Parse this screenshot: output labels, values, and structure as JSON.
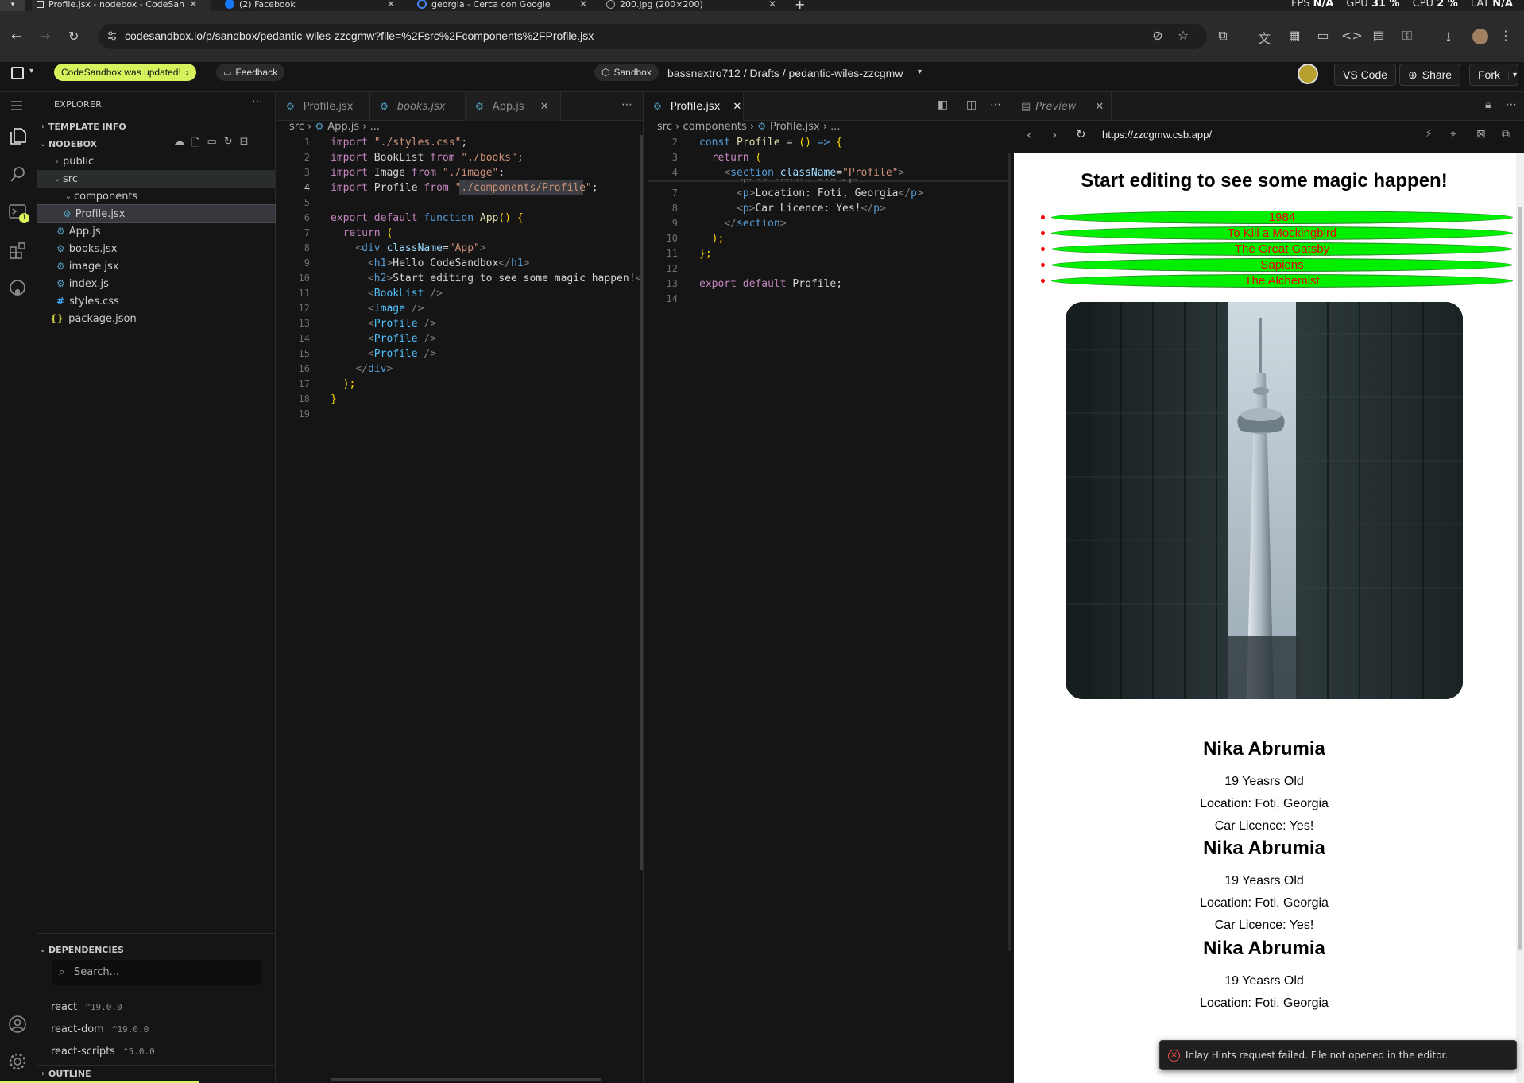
{
  "browser": {
    "tabs": [
      {
        "title": "Profile.jsx - nodebox - CodeSan",
        "icon": "codesandbox-icon"
      },
      {
        "title": "(2) Facebook",
        "icon": "facebook-icon"
      },
      {
        "title": "georgia - Cerca con Google",
        "icon": "google-icon"
      },
      {
        "title": "200.jpg (200×200)",
        "icon": "globe-icon"
      }
    ],
    "new_tab": "+",
    "stats": {
      "fps_label": "FPS",
      "fps": "N/A",
      "gpu_label": "GPU",
      "gpu": "31 %",
      "cpu_label": "CPU",
      "cpu": "2 %",
      "lat_label": "LAT",
      "lat": "N/A"
    },
    "url": "codesandbox.io/p/sandbox/pedantic-wiles-zzcgmw?file=%2Fsrc%2Fcomponents%2FProfile.jsx"
  },
  "header": {
    "update_badge": "CodeSandbox was updated!",
    "feedback": "Feedback",
    "sandbox_badge": "Sandbox",
    "breadcrumb": "bassnextro712 / Drafts / pedantic-wiles-zzcgmw",
    "vscode": "VS Code",
    "share": "Share",
    "fork": "Fork"
  },
  "explorer": {
    "title": "EXPLORER",
    "template_info": "TEMPLATE INFO",
    "project": "NODEBOX",
    "tree": {
      "public": "public",
      "src": "src",
      "components": "components",
      "profile": "Profile.jsx",
      "app": "App.js",
      "books": "books.jsx",
      "image": "image.jsx",
      "index": "index.js",
      "styles": "styles.css",
      "package": "package.json"
    },
    "dependencies_title": "DEPENDENCIES",
    "search_placeholder": "Search...",
    "dependencies": [
      {
        "name": "react",
        "version": "^19.0.0"
      },
      {
        "name": "react-dom",
        "version": "^19.0.0"
      },
      {
        "name": "react-scripts",
        "version": "^5.0.0"
      }
    ],
    "outline": "OUTLINE",
    "terminal_badge": "1"
  },
  "editor_left": {
    "tabs": [
      "Profile.jsx",
      "books.jsx",
      "App.js"
    ],
    "breadcrumb": [
      "src",
      "App.js",
      "..."
    ],
    "line_numbers": [
      "1",
      "2",
      "3",
      "4",
      "5",
      "6",
      "7",
      "8",
      "9",
      "10",
      "11",
      "12",
      "13",
      "14",
      "15",
      "16",
      "17",
      "18",
      "19"
    ]
  },
  "editor_right": {
    "tab": "Profile.jsx",
    "breadcrumb": [
      "src",
      "components",
      "Profile.jsx",
      "..."
    ],
    "line_numbers_top": [
      "2",
      "3",
      "4"
    ],
    "line_numbers": [
      "7",
      "8",
      "9",
      "10",
      "11",
      "12",
      "13",
      "14"
    ]
  },
  "preview": {
    "tab": "Preview",
    "url": "https://zzcgmw.csb.app/",
    "heading": "Start editing to see some magic happen!",
    "books": [
      "1984",
      "To Kill a Mockingbird",
      "The Great Gatsby",
      "Sapiens",
      "The Alchemist"
    ],
    "profiles": [
      {
        "name": "Nika Abrumia",
        "age": "19 Yeasrs Old",
        "location": "Location: Foti, Georgia",
        "car": "Car Licence: Yes!"
      },
      {
        "name": "Nika Abrumia",
        "age": "19 Yeasrs Old",
        "location": "Location: Foti, Georgia",
        "car": "Car Licence: Yes!"
      },
      {
        "name": "Nika Abrumia",
        "age": "19 Yeasrs Old",
        "location": "Location: Foti, Georgia"
      }
    ]
  },
  "toast": {
    "message": "Inlay Hints request failed. File not opened in the editor."
  },
  "colors": {
    "accent_badge": "#d6f25d",
    "book_fill": "#00ee00",
    "book_text": "#ee0000",
    "error": "#f14c4c"
  }
}
